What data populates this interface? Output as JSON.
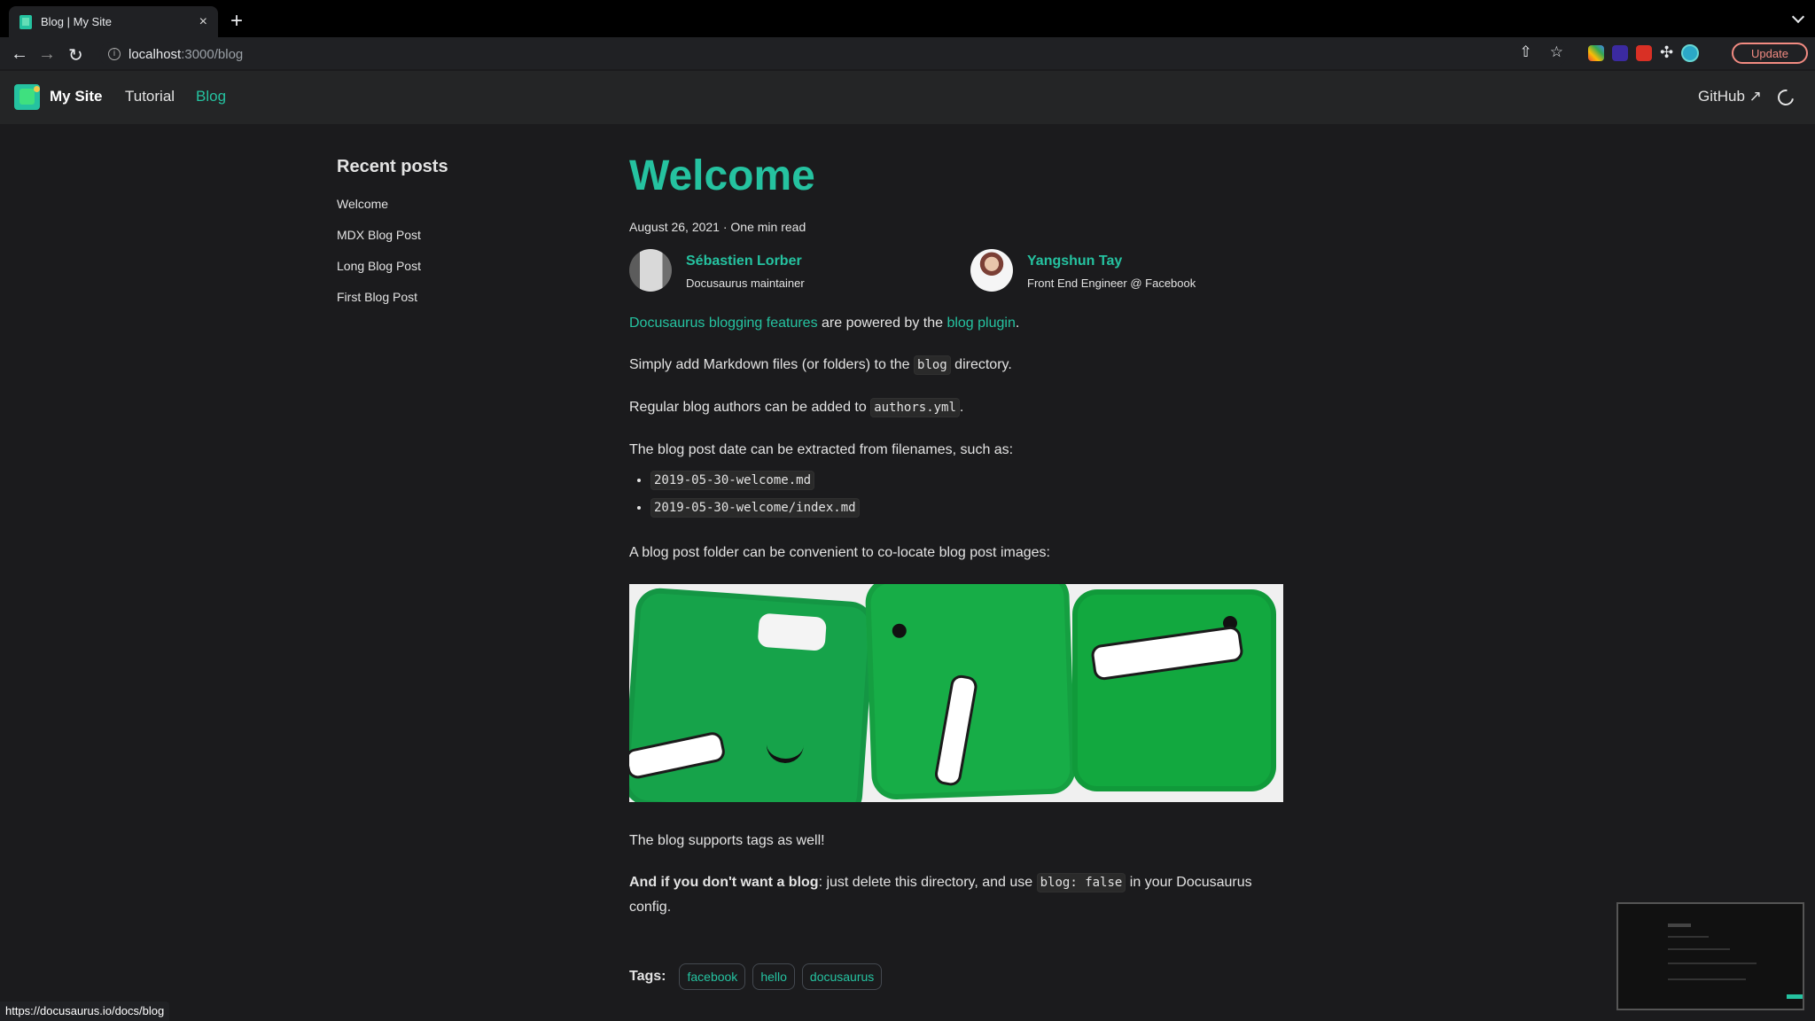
{
  "browser": {
    "tab_title": "Blog | My Site",
    "address_host": "localhost",
    "address_path": ":3000/blog",
    "update_label": "Update",
    "status_url": "https://docusaurus.io/docs/blog"
  },
  "site": {
    "brand": "My Site",
    "nav": [
      "Tutorial",
      "Blog"
    ],
    "github": "GitHub"
  },
  "sidebar": {
    "title": "Recent posts",
    "items": [
      "Welcome",
      "MDX Blog Post",
      "Long Blog Post",
      "First Blog Post"
    ]
  },
  "post": {
    "title": "Welcome",
    "meta": "August 26, 2021 · One min read",
    "authors": [
      {
        "name": "Sébastien Lorber",
        "role": "Docusaurus maintainer"
      },
      {
        "name": "Yangshun Tay",
        "role": "Front End Engineer @ Facebook"
      }
    ],
    "paragraphs": {
      "features_link": "Docusaurus blogging features",
      "powered": " are powered by the ",
      "plugin_link": "blog plugin",
      "period": ".",
      "simply_before": "Simply add Markdown files (or folders) to the ",
      "blog_code": "blog",
      "simply_after": " directory.",
      "authors_before": "Regular blog authors can be added to ",
      "authors_code": "authors.yml",
      "authors_after": ".",
      "date": "The blog post date can be extracted from filenames, such as:",
      "folder": "A blog post folder can be convenient to co-locate blog post images:",
      "tags": "The blog supports tags as well!",
      "delete_bold": "And if you don't want a blog",
      "delete_mid": ": just delete this directory, and use ",
      "delete_code": "blog: false",
      "delete_after": " in your Docusaurus config."
    },
    "filenames": [
      "2019-05-30-welcome.md",
      "2019-05-30-welcome/index.md"
    ],
    "tags_label": "Tags:",
    "tags": [
      "facebook",
      "hello",
      "docusaurus"
    ]
  },
  "colors": {
    "accent": "#25c2a0",
    "background": "#1b1b1d",
    "navbar": "#242526"
  },
  "icons": [
    "back-icon",
    "forward-icon",
    "reload-icon",
    "info-icon",
    "share-icon",
    "star-icon",
    "extension-icon",
    "external-link-icon",
    "dark-mode-icon"
  ]
}
